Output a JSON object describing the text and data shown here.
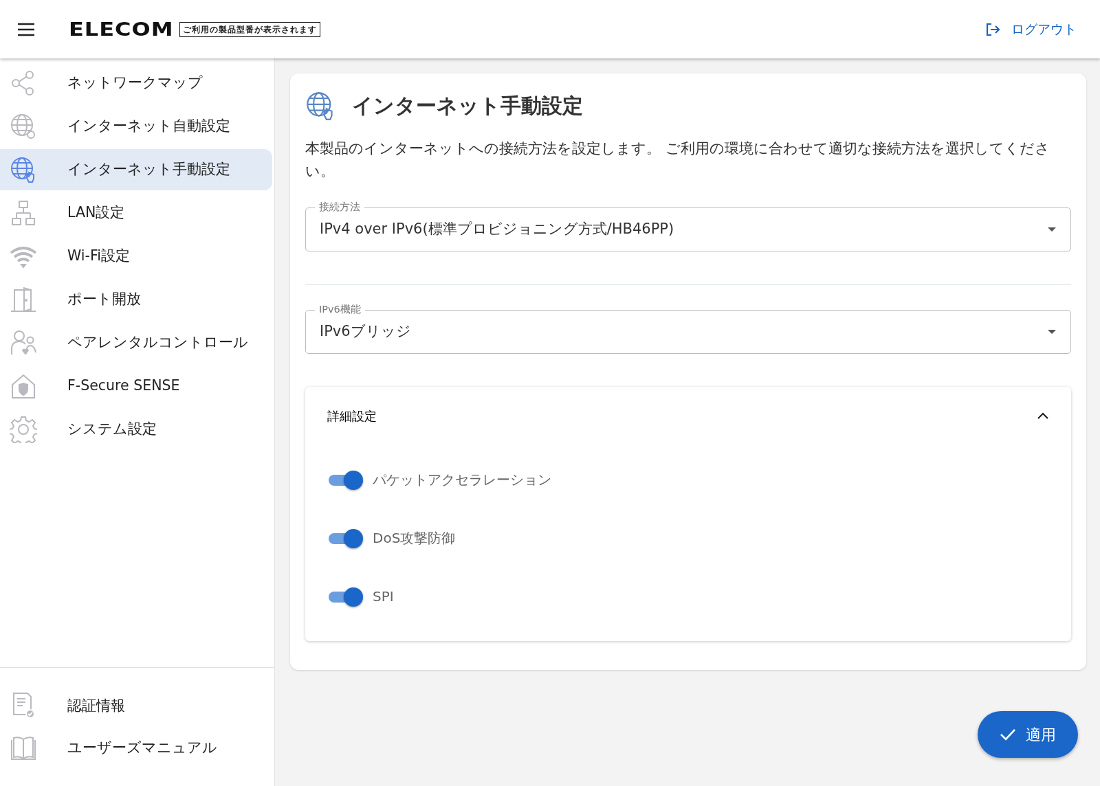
{
  "header": {
    "logo": "ELECOM",
    "model_label": "ご利用の製品型番が表示されます",
    "logout": "ログアウト"
  },
  "sidebar": {
    "items": [
      {
        "label": "ネットワークマップ",
        "selected": false
      },
      {
        "label": "インターネット自動設定",
        "selected": false
      },
      {
        "label": "インターネット手動設定",
        "selected": true
      },
      {
        "label": "LAN設定",
        "selected": false
      },
      {
        "label": "Wi-Fi設定",
        "selected": false
      },
      {
        "label": "ポート開放",
        "selected": false
      },
      {
        "label": "ペアレンタルコントロール",
        "selected": false
      },
      {
        "label": "F-Secure SENSE",
        "selected": false
      },
      {
        "label": "システム設定",
        "selected": false
      }
    ],
    "footer_items": [
      {
        "label": "認証情報"
      },
      {
        "label": "ユーザーズマニュアル"
      }
    ]
  },
  "page": {
    "title": "インターネット手動設定",
    "description": "本製品のインターネットへの接続方法を設定します。 ご利用の環境に合わせて適切な接続方法を選択してください。",
    "selects": [
      {
        "label": "接続方法",
        "value": "IPv4 over IPv6(標準プロビジョニング方式/HB46PP)"
      },
      {
        "label": "IPv6機能",
        "value": "IPv6ブリッジ"
      }
    ],
    "advanced": {
      "title": "詳細設定",
      "expanded": true,
      "toggles": [
        {
          "label": "パケットアクセラレーション",
          "on": true
        },
        {
          "label": "DoS攻撃防御",
          "on": true
        },
        {
          "label": "SPI",
          "on": true
        }
      ]
    }
  },
  "apply_button": "適用"
}
